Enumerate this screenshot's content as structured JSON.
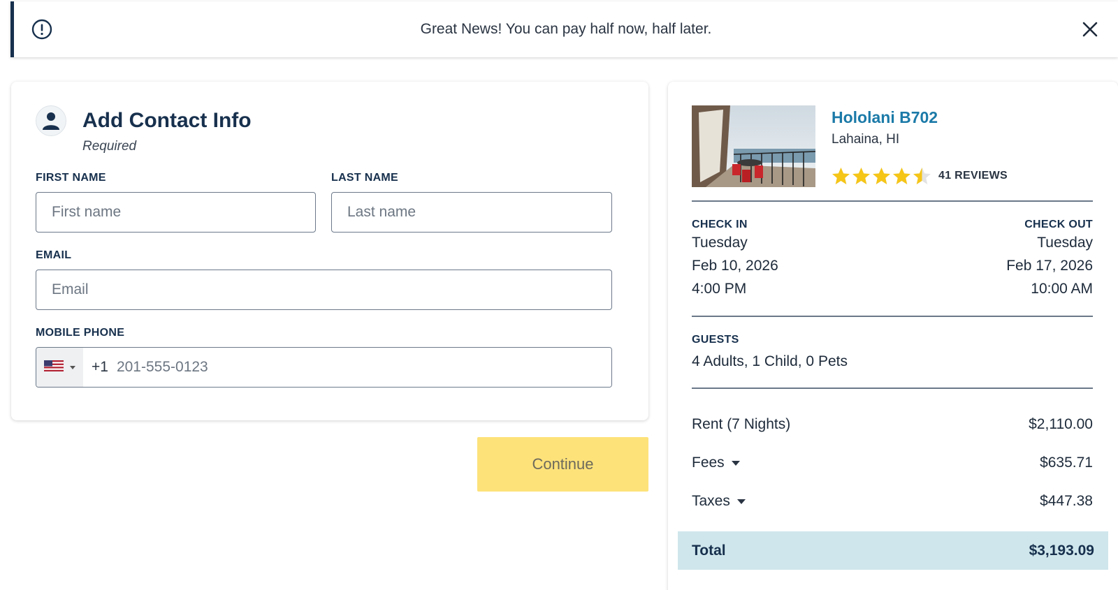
{
  "banner": {
    "message": "Great News! You can pay half now, half later."
  },
  "contact": {
    "title": "Add Contact Info",
    "subtitle": "Required",
    "first_name_label": "FIRST NAME",
    "first_name_placeholder": "First name",
    "last_name_label": "LAST NAME",
    "last_name_placeholder": "Last name",
    "email_label": "EMAIL",
    "email_placeholder": "Email",
    "phone_label": "MOBILE PHONE",
    "phone_dial_code": "+1",
    "phone_placeholder": "201-555-0123",
    "country_flag_icon": "us-flag-icon",
    "continue_label": "Continue"
  },
  "property": {
    "name": "Hololani B702",
    "location": "Lahaina, HI",
    "rating": 4.5,
    "rating_max": 5,
    "reviews": "41 REVIEWS"
  },
  "stay": {
    "check_in_label": "CHECK IN",
    "check_in_day": "Tuesday",
    "check_in_date": "Feb 10, 2026",
    "check_in_time": "4:00 PM",
    "check_out_label": "CHECK OUT",
    "check_out_day": "Tuesday",
    "check_out_date": "Feb 17, 2026",
    "check_out_time": "10:00 AM",
    "guests_label": "GUESTS",
    "guests_value": "4 Adults, 1 Child, 0 Pets"
  },
  "pricing": {
    "rent_label": "Rent (7 Nights)",
    "rent_amount": "$2,110.00",
    "fees_label": "Fees",
    "fees_amount": "$635.71",
    "taxes_label": "Taxes",
    "taxes_amount": "$447.38",
    "total_label": "Total",
    "total_amount": "$3,193.09"
  },
  "colors": {
    "navy": "#17304d",
    "link_blue": "#1b7aa8",
    "continue_yellow": "#fde27a",
    "total_bar": "#cfe6ec",
    "star_gold": "#f5c518"
  }
}
